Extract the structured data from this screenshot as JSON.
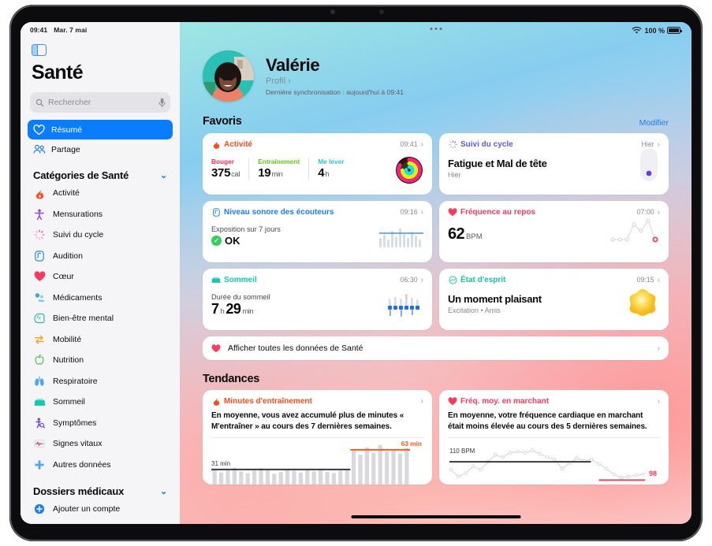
{
  "status_bar": {
    "time": "09:41",
    "date": "Mar. 7 mai",
    "wifi_icon": "wifi-icon",
    "battery_text": "100 %",
    "battery_icon": "battery-full-icon"
  },
  "sidebar": {
    "toggle_icon": "sidebar-toggle-icon",
    "title": "Santé",
    "search": {
      "placeholder": "Rechercher",
      "value": "",
      "icon": "search-icon",
      "mic_icon": "microphone-icon"
    },
    "nav": [
      {
        "label": "Résumé",
        "icon": "heart-outline-icon",
        "active": true
      },
      {
        "label": "Partage",
        "icon": "people-icon",
        "active": false
      }
    ],
    "categories_header": {
      "label": "Catégories de Santé",
      "chevron": "chevron-down-icon"
    },
    "categories": [
      {
        "label": "Activité",
        "icon": "flame-icon",
        "color": "#f94d21"
      },
      {
        "label": "Mensurations",
        "icon": "body-icon",
        "color": "#8b4ae2"
      },
      {
        "label": "Suivi du cycle",
        "icon": "cycle-icon",
        "color": "#f85b8e"
      },
      {
        "label": "Audition",
        "icon": "ear-icon",
        "color": "#2e8bf5"
      },
      {
        "label": "Cœur",
        "icon": "heart-icon",
        "color": "#fb3b5c"
      },
      {
        "label": "Médicaments",
        "icon": "pills-icon",
        "color": "#3aa4e0"
      },
      {
        "label": "Bien-être mental",
        "icon": "brain-icon",
        "color": "#24b6a8"
      },
      {
        "label": "Mobilité",
        "icon": "mobility-icon",
        "color": "#f7a01d"
      },
      {
        "label": "Nutrition",
        "icon": "apple-icon",
        "color": "#4cc24c"
      },
      {
        "label": "Respiratoire",
        "icon": "lungs-icon",
        "color": "#4da6f0"
      },
      {
        "label": "Sommeil",
        "icon": "bed-icon",
        "color": "#17c6b0"
      },
      {
        "label": "Symptômes",
        "icon": "symptoms-icon",
        "color": "#6a45d8"
      },
      {
        "label": "Signes vitaux",
        "icon": "vitals-icon",
        "color": "#fb3b5c"
      },
      {
        "label": "Autres données",
        "icon": "plus-icon",
        "color": "#4da6f0"
      }
    ],
    "records_header": {
      "label": "Dossiers médicaux",
      "chevron": "chevron-down-icon"
    },
    "add_account": {
      "label": "Ajouter un compte",
      "icon": "plus-circle-icon"
    }
  },
  "profile": {
    "avatar_icon": "user-avatar",
    "name": "Valérie",
    "link_label": "Profil",
    "link_chevron": "chevron-right-icon",
    "sync_text": "Dernière synchronisation : aujourd'hui à 09:41"
  },
  "favorites": {
    "section_title": "Favoris",
    "edit_label": "Modifier",
    "cards": [
      {
        "id": "activity",
        "title": "Activité",
        "icon": "flame-icon",
        "color": "#f94d21",
        "time": "09:41",
        "metrics": [
          {
            "label": "Bouger",
            "color": "#fb2d55",
            "value": "375",
            "unit": "cal"
          },
          {
            "label": "Entraînement",
            "color": "#7ae81c",
            "value": "19",
            "unit": "min"
          },
          {
            "label": "Me lever",
            "color": "#3fd8e8",
            "value": "4",
            "unit": "h"
          }
        ],
        "graphic": "activity-rings-icon"
      },
      {
        "id": "cycle",
        "title": "Suivi du cycle",
        "icon": "cycle-icon",
        "color": "#5b5bf0",
        "time": "Hier",
        "headline": "Fatigue et Mal de tête",
        "sub": "Hier",
        "graphic": "cycle-pill-icon"
      },
      {
        "id": "headphone",
        "title": "Niveau sonore des écouteurs",
        "icon": "ear-audio-icon",
        "color": "#1f7cf2",
        "time": "09:16",
        "label": "Exposition sur 7 jours",
        "status_badge": "check-icon",
        "status_text": "OK",
        "graphic": "audio-bars-chart"
      },
      {
        "id": "resting-hr",
        "title": "Fréquence au repos",
        "icon": "heart-icon",
        "color": "#fb3b5c",
        "time": "07:00",
        "value": "62",
        "unit": "BPM",
        "graphic": "hr-line-chart"
      },
      {
        "id": "sleep",
        "title": "Sommeil",
        "icon": "bed-icon",
        "color": "#17c6b0",
        "time": "06:30",
        "label": "Durée du sommeil",
        "hours": "7",
        "hours_unit": "h",
        "minutes": "29",
        "minutes_unit": "min",
        "graphic": "sleep-bars-chart"
      },
      {
        "id": "state-of-mind",
        "title": "État d'esprit",
        "icon": "mind-icon",
        "color": "#1fbfa8",
        "time": "09:15",
        "headline": "Un moment plaisant",
        "sub": "Excitation • Amis",
        "graphic": "yellow-star-blob"
      }
    ],
    "show_all": {
      "label": "Afficher toutes les données de Santé",
      "icon": "heart-icon",
      "chevron": "chevron-right-icon"
    }
  },
  "trends": {
    "section_title": "Tendances",
    "cards": [
      {
        "id": "exercise-minutes",
        "title": "Minutes d'entraînement",
        "icon": "flame-icon",
        "color": "#f94d21",
        "description": "En moyenne, vous avez accumulé plus de minutes « M'entraîner » au cours des 7 dernières semaines."
      },
      {
        "id": "walking-hr",
        "title": "Fréq. moy. en marchant",
        "icon": "heart-icon",
        "color": "#fb3b5c",
        "description": "En moyenne, votre fréquence cardiaque en marchant était moins élevée au cours des 5 dernières semaines."
      }
    ]
  },
  "chart_data": [
    {
      "id": "exercise-minutes",
      "type": "bar",
      "title": "Minutes d'entraînement",
      "ylabel": "min",
      "baseline_label": "31 min",
      "baseline_value": 31,
      "highlight_label": "63 min",
      "highlight_value": 63,
      "baseline_color": "#3a3a3c",
      "highlight_color": "#ff5722",
      "bar_color": "#d8d8dd",
      "values": [
        30,
        26,
        31,
        34,
        28,
        25,
        29,
        33,
        30,
        24,
        27,
        31,
        29,
        26,
        30,
        28,
        32,
        27,
        25,
        29,
        31,
        62,
        55,
        67,
        58,
        71,
        60,
        64,
        57,
        66
      ],
      "highlight_start_index": 21
    },
    {
      "id": "walking-hr",
      "type": "line",
      "title": "Fréq. moy. en marchant",
      "ylabel": "BPM",
      "baseline_label": "110 BPM",
      "baseline_value": 110,
      "highlight_label": "98",
      "highlight_value": 98,
      "baseline_color": "#3a3a3c",
      "highlight_color": "#fb3b5c",
      "line_color": "#d8d8dd",
      "values": [
        103,
        97,
        100,
        106,
        103,
        110,
        116,
        114,
        118,
        119,
        118,
        120,
        117,
        114,
        112,
        104,
        109,
        113,
        111,
        112,
        108,
        104,
        99,
        96,
        97,
        98,
        99
      ]
    }
  ]
}
